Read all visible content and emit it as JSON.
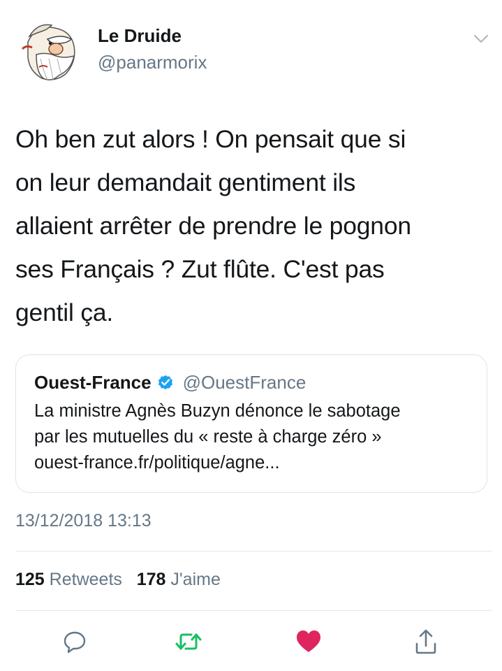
{
  "author": {
    "name": "Le Druide",
    "handle": "@panarmorix",
    "avatar_icon": "druid-cartoon-avatar"
  },
  "tweet": {
    "lines": [
      "Oh ben zut alors ! On pensait que si",
      "on leur demandait gentiment ils",
      "allaient arrêter de prendre le pognon",
      "ses Français ? Zut flûte. C'est pas",
      "gentil ça."
    ]
  },
  "quoted_tweet": {
    "name": "Ouest-France",
    "handle": "@OuestFrance",
    "verified": true,
    "lines": [
      "La ministre Agnès Buzyn dénonce le sabotage",
      "par les mutuelles du « reste à charge zéro »",
      "ouest-france.fr/politique/agne..."
    ]
  },
  "timestamp": "13/12/2018 13:13",
  "stats": {
    "retweets_count": "125",
    "retweets_label": "Retweets",
    "likes_count": "178",
    "likes_label": "J'aime"
  },
  "actions": [
    "reply-icon",
    "retweet-icon",
    "like-icon",
    "share-icon"
  ],
  "colors": {
    "text": "#14171a",
    "secondary": "#657786",
    "verified": "#1da1f2",
    "retweet": "#17bf63",
    "like": "#e0245e",
    "divider": "#e1e8ed"
  }
}
